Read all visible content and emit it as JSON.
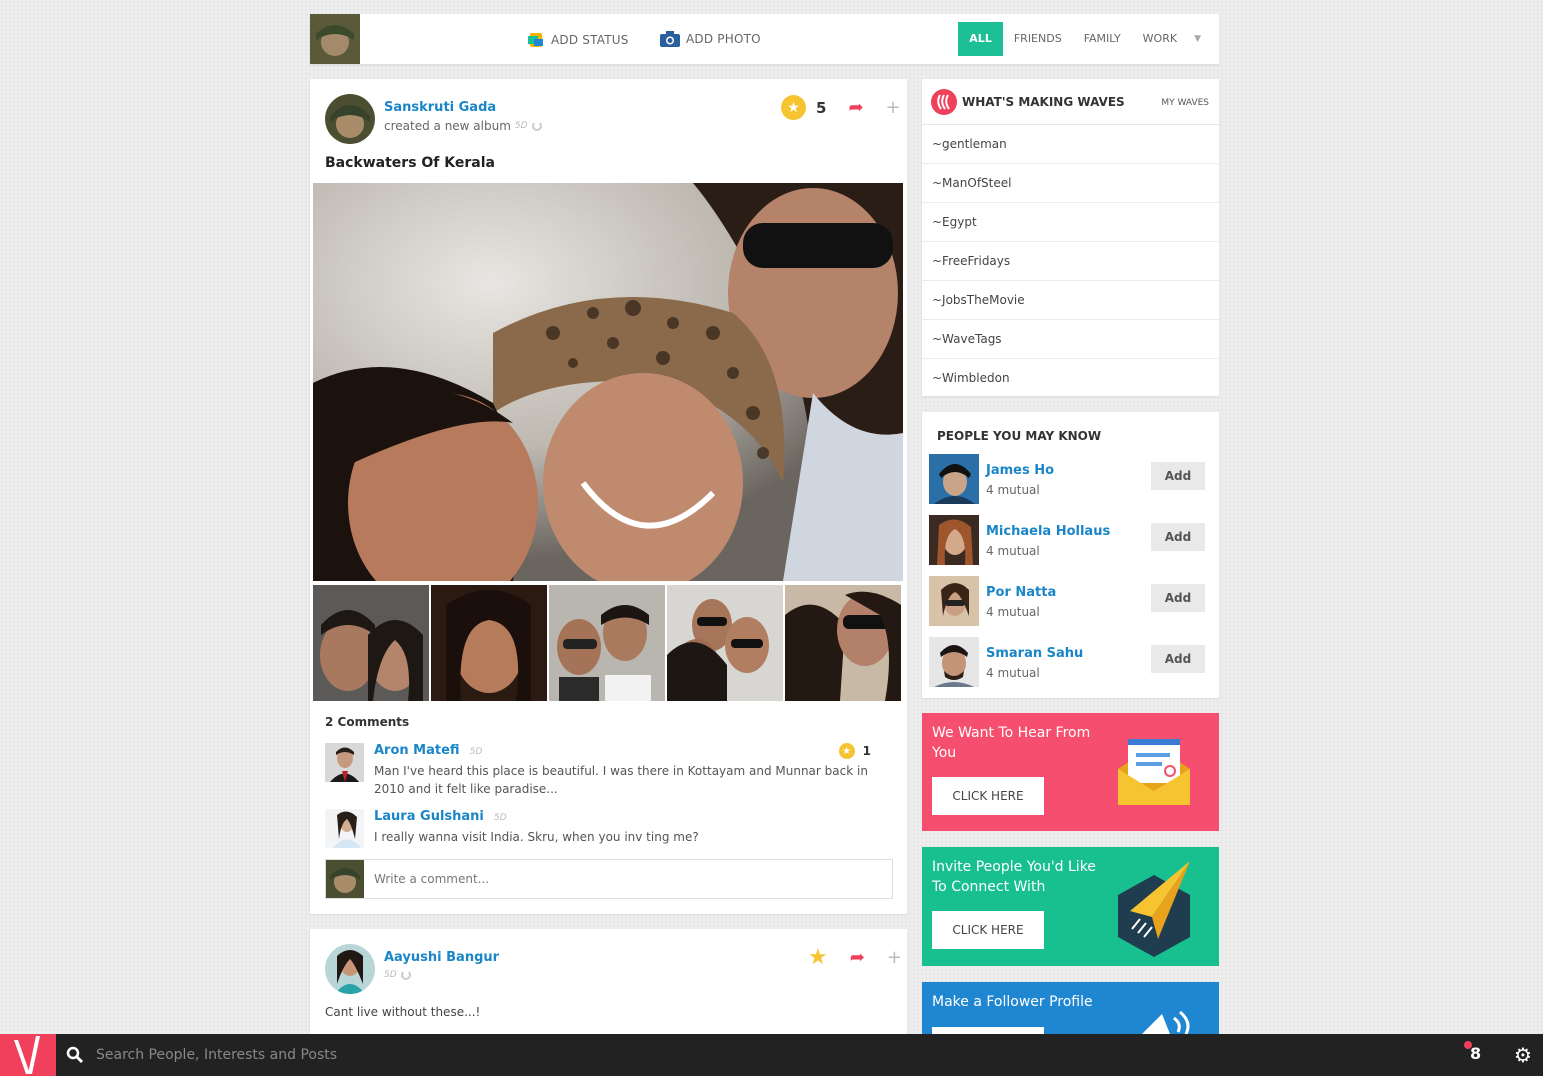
{
  "topbar": {
    "add_status": "ADD STATUS",
    "add_photo": "ADD PHOTO",
    "filters": [
      "ALL",
      "FRIENDS",
      "FAMILY",
      "WORK"
    ],
    "active_filter": "ALL"
  },
  "post1": {
    "author": "Sanskruti Gada",
    "action": "created a new album",
    "time": "5D",
    "star_count": "5",
    "title": "Backwaters Of Kerala",
    "comments_label": "2 Comments",
    "comments": [
      {
        "name": "Aron Matefi",
        "time": "5D",
        "text": "Man I've heard this place is beautiful. I was there in Kottayam and Munnar back in 2010 and it felt like paradise...",
        "stars": "1"
      },
      {
        "name": "Laura Gulshani",
        "time": "5D",
        "text": "I really wanna visit India. Skru, when you inv ting me?"
      }
    ],
    "comment_placeholder": "Write a comment..."
  },
  "post2": {
    "author": "Aayushi Bangur",
    "time": "5D",
    "text": "Cant live without these...!"
  },
  "waves": {
    "title": "WHAT'S MAKING WAVES",
    "my_waves": "MY WAVES",
    "items": [
      "~gentleman",
      "~ManOfSteel",
      "~Egypt",
      "~FreeFridays",
      "~JobsTheMovie",
      "~WaveTags",
      "~Wimbledon"
    ]
  },
  "pymk": {
    "title": "PEOPLE YOU MAY KNOW",
    "add_label": "Add",
    "people": [
      {
        "name": "James Ho",
        "mutual": "4 mutual"
      },
      {
        "name": "Michaela Hollaus",
        "mutual": "4 mutual"
      },
      {
        "name": "Por Natta",
        "mutual": "4 mutual"
      },
      {
        "name": "Smaran Sahu",
        "mutual": "4 mutual"
      }
    ]
  },
  "promos": [
    {
      "text": "We Want To Hear From You",
      "button": "CLICK HERE",
      "color": "#f64e6e"
    },
    {
      "text": "Invite People You'd Like To Connect With",
      "button": "CLICK HERE",
      "color": "#19c08f"
    },
    {
      "text": "Make a Follower Profile",
      "color": "#1f87d2"
    }
  ],
  "bottombar": {
    "search_placeholder": "Search People, Interests and Posts",
    "notifications": "8"
  },
  "colors": {
    "accent_green": "#1cbf96",
    "accent_pink": "#f0405c",
    "link_blue": "#1a86c8",
    "star_yellow": "#f6c431"
  }
}
